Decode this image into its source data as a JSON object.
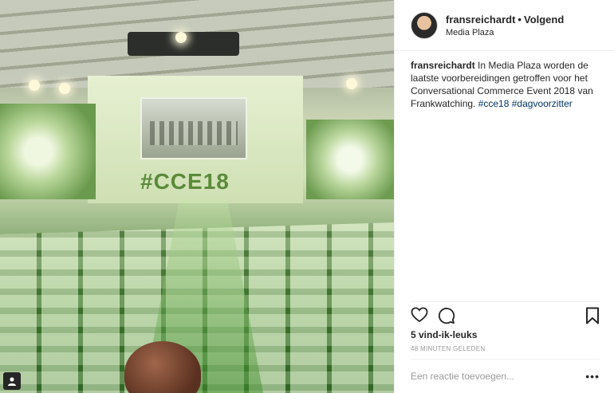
{
  "post": {
    "username": "fransreichardt",
    "separator": "•",
    "follow_label": "Volgend",
    "location": "Media Plaza",
    "caption_user": "fransreichardt",
    "caption_text": " In Media Plaza worden de laatste voorbereidingen getroffen voor het Conversational Commerce Event 2018 van Frankwatching. ",
    "hashtag1": "#cce18",
    "hashtag2": "#dagvoorzitter",
    "likes": "5 vind-ik-leuks",
    "timestamp": "48 MINUTEN GELEDEN",
    "comment_placeholder": "Een reactie toevoegen...",
    "more_label": "•••"
  },
  "photo": {
    "stage_text": "#CCE18"
  },
  "icons": {
    "heart": "heart-icon",
    "comment": "comment-icon",
    "bookmark": "bookmark-icon",
    "user_tag": "user-tag-icon"
  }
}
